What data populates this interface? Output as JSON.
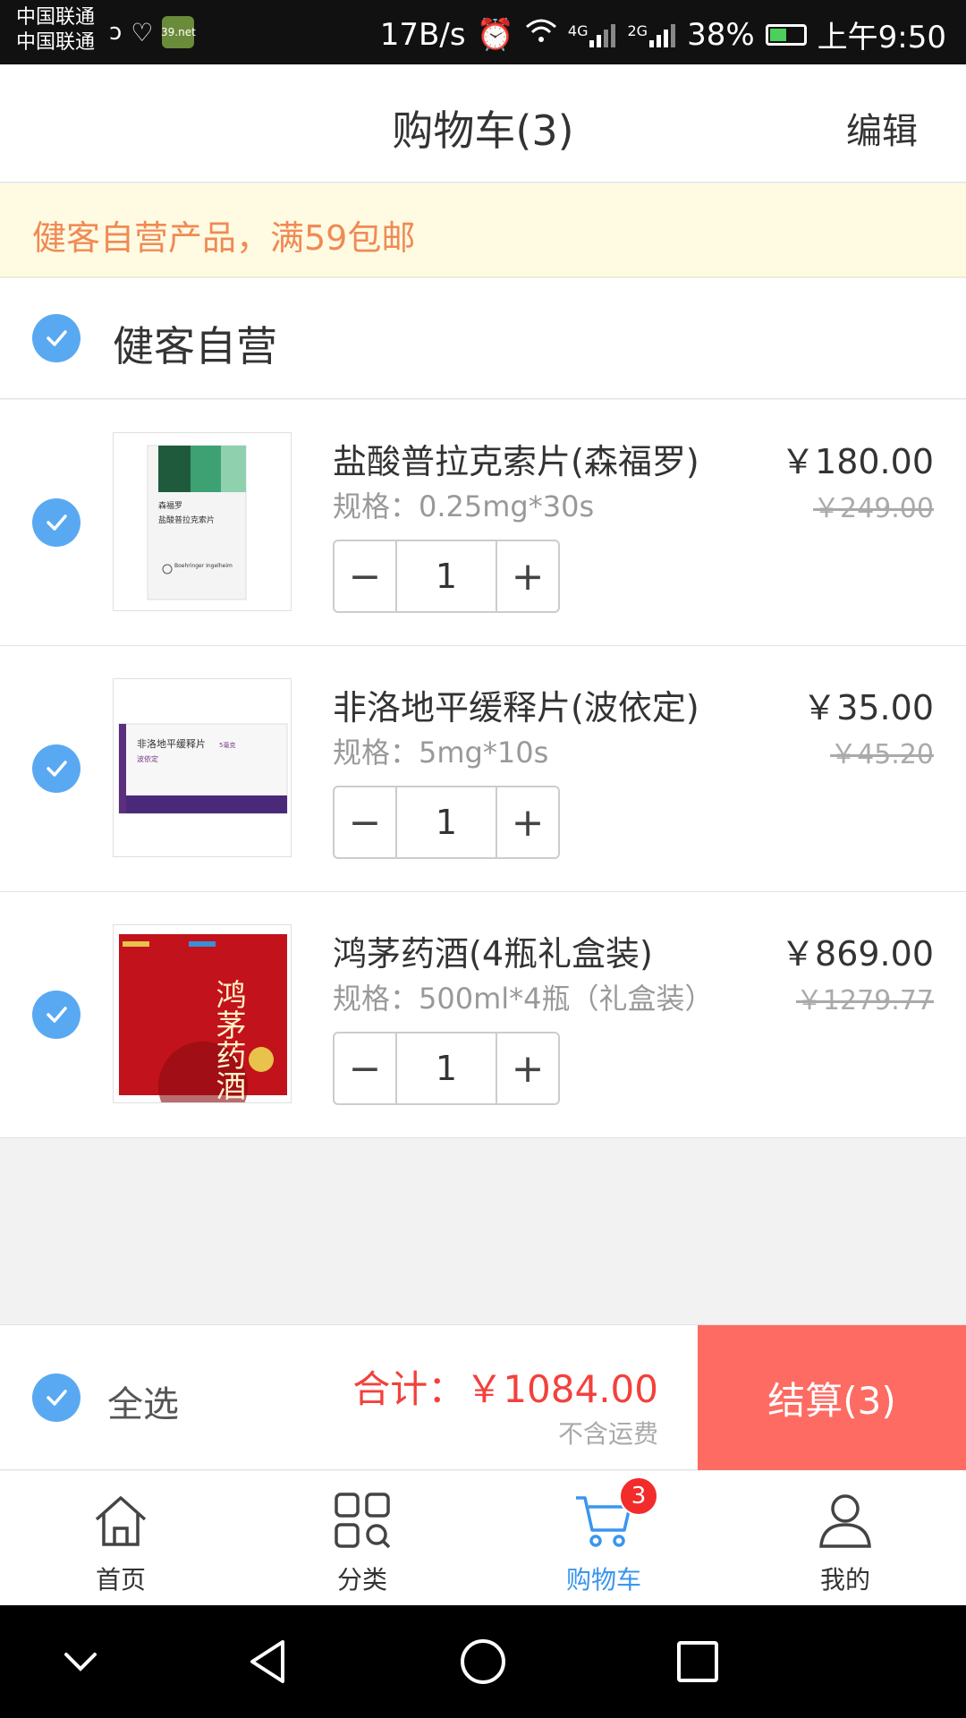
{
  "status_bar": {
    "carrier_1": "中国联通",
    "carrier_2": "中国联通",
    "app_icon_text": "39.net",
    "speed": "17B/s",
    "net_4g": "4G",
    "net_2g": "2G",
    "battery": "38%",
    "time": "上午9:50"
  },
  "header": {
    "title": "购物车(3)",
    "edit_label": "编辑"
  },
  "notice": {
    "text": "健客自营产品，满59包邮"
  },
  "shop": {
    "name": "健客自营",
    "checked": true
  },
  "items": [
    {
      "name": "盐酸普拉克索片(森福罗)",
      "spec": "规格：0.25mg*30s",
      "price": "￥180.00",
      "original_price": "￥249.00",
      "qty": "1",
      "checked": true,
      "thumb_text_1": "森福罗",
      "thumb_text_2": "盐酸普拉克索片",
      "thumb_text_3": "Boehringer Ingelheim"
    },
    {
      "name": "非洛地平缓释片(波依定)",
      "spec": "规格：5mg*10s",
      "price": "￥35.00",
      "original_price": "￥45.20",
      "qty": "1",
      "checked": true,
      "thumb_text_1": "非洛地平缓释片",
      "thumb_text_2": "5毫克",
      "thumb_text_3": "波依定"
    },
    {
      "name": "鸿茅药酒(4瓶礼盒装)",
      "spec": "规格：500ml*4瓶（礼盒装）",
      "price": "￥869.00",
      "original_price": "￥1279.77",
      "qty": "1",
      "checked": true,
      "thumb_text_1": "鸿茅药酒"
    }
  ],
  "stepper": {
    "minus": "−",
    "plus": "+"
  },
  "checkout": {
    "select_all_label": "全选",
    "total_label": "合计：",
    "total_value": "￥1084.00",
    "shipping_note": "不含运费",
    "pay_label": "结算(3)"
  },
  "tabs": [
    {
      "label": "首页",
      "icon": "home-icon"
    },
    {
      "label": "分类",
      "icon": "category-icon"
    },
    {
      "label": "购物车",
      "icon": "cart-icon",
      "badge": "3",
      "active": true
    },
    {
      "label": "我的",
      "icon": "user-icon"
    }
  ],
  "colors": {
    "accent": "#3a96ee",
    "checkout": "#fd6b62",
    "price_red": "#f2413c",
    "notice_text": "#f08a55",
    "check_blue": "#59a9f2"
  }
}
